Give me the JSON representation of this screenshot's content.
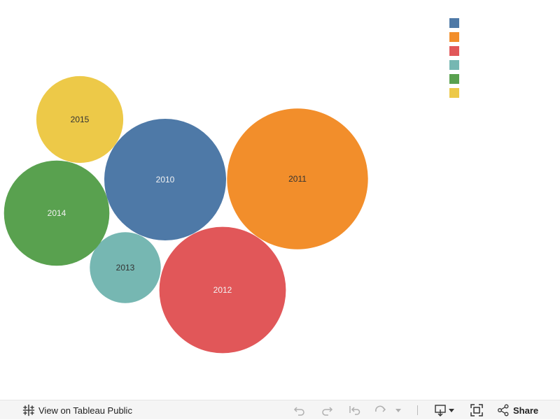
{
  "chart_data": {
    "type": "packed-bubble",
    "title": "",
    "legend_position": "top-right",
    "bubbles": [
      {
        "label": "2010",
        "color": "#4e79a7",
        "label_color": "#f2f2f2",
        "relative_size": 1.0
      },
      {
        "label": "2011",
        "color": "#f28e2b",
        "label_color": "#333333",
        "relative_size": 1.34
      },
      {
        "label": "2012",
        "color": "#e15759",
        "label_color": "#f2f2f2",
        "relative_size": 1.08
      },
      {
        "label": "2013",
        "color": "#76b7b2",
        "label_color": "#333333",
        "relative_size": 0.34
      },
      {
        "label": "2014",
        "color": "#59a14f",
        "label_color": "#f2f2f2",
        "relative_size": 0.75
      },
      {
        "label": "2015",
        "color": "#edc948",
        "label_color": "#333333",
        "relative_size": 0.51
      }
    ],
    "legend_colors": [
      "#4e79a7",
      "#f28e2b",
      "#e15759",
      "#76b7b2",
      "#59a14f",
      "#edc948"
    ]
  },
  "toolbar": {
    "view_label": "View on Tableau Public",
    "share_label": "Share"
  },
  "icons": {
    "tableau": "tableau-logo-icon",
    "undo": "undo-icon",
    "redo": "redo-icon",
    "revert": "revert-icon",
    "refresh": "refresh-icon",
    "pause": "pause-dropdown-icon",
    "download": "download-icon",
    "fullscreen": "fullscreen-icon",
    "share": "share-icon"
  }
}
